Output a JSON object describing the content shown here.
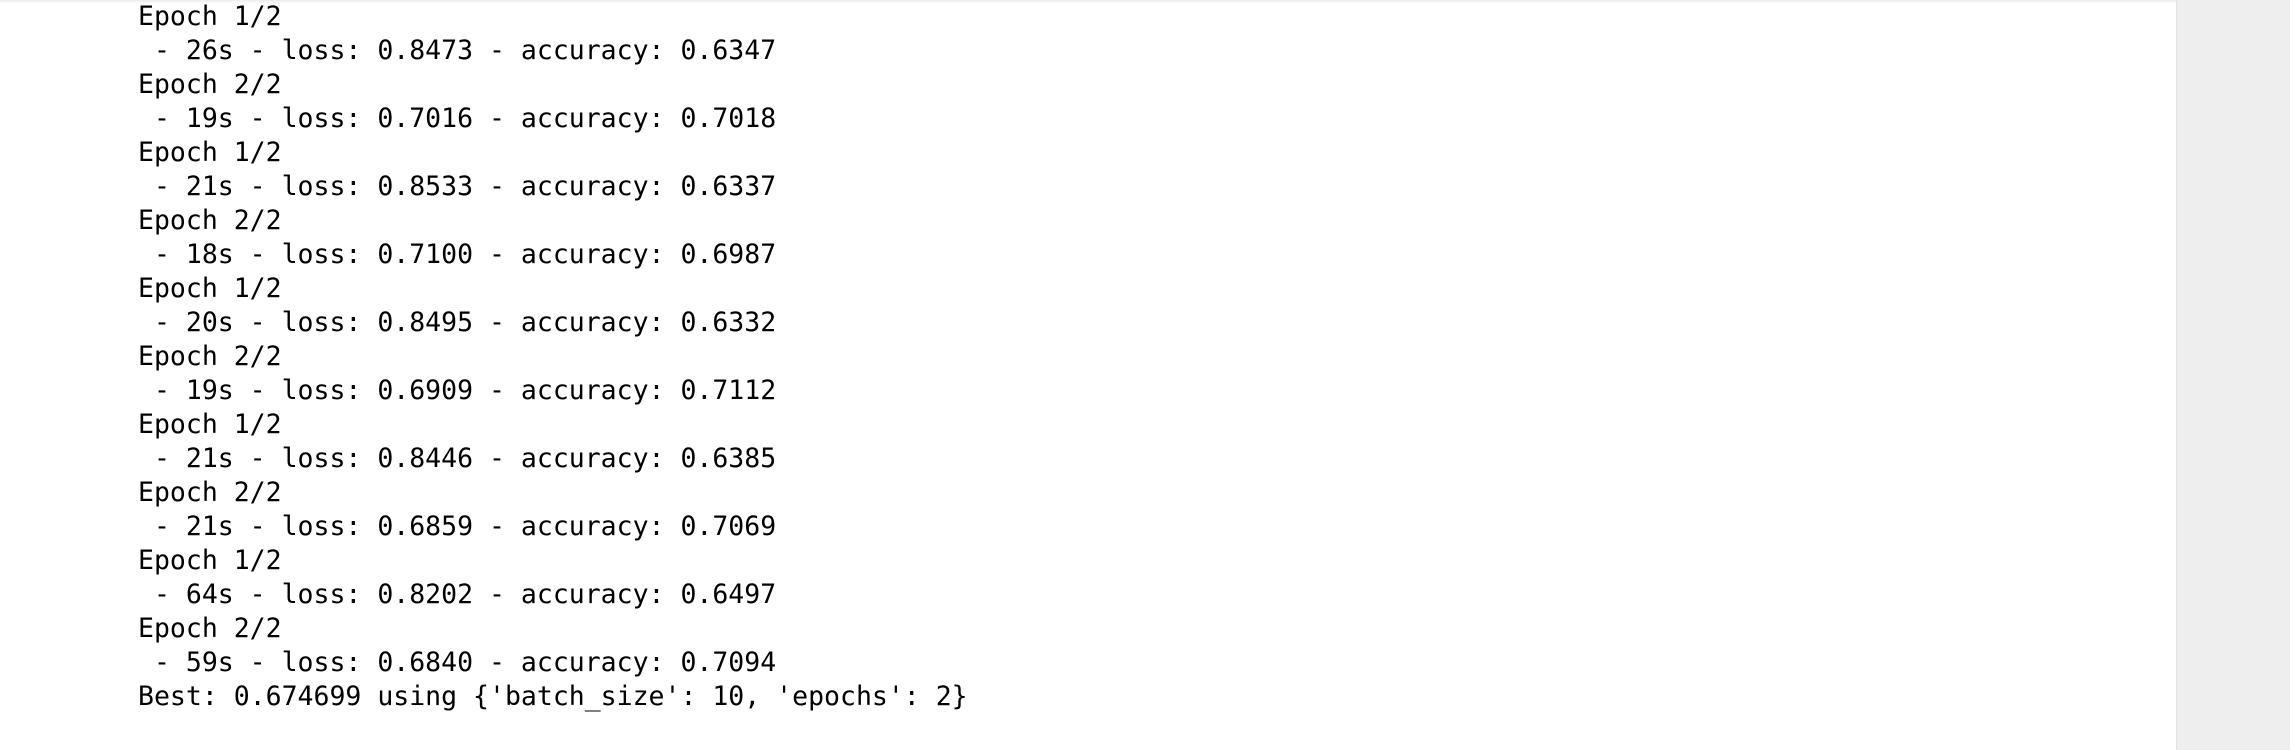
{
  "output": {
    "lines": [
      "Epoch 1/2",
      " - 26s - loss: 0.8473 - accuracy: 0.6347",
      "Epoch 2/2",
      " - 19s - loss: 0.7016 - accuracy: 0.7018",
      "Epoch 1/2",
      " - 21s - loss: 0.8533 - accuracy: 0.6337",
      "Epoch 2/2",
      " - 18s - loss: 0.7100 - accuracy: 0.6987",
      "Epoch 1/2",
      " - 20s - loss: 0.8495 - accuracy: 0.6332",
      "Epoch 2/2",
      " - 19s - loss: 0.6909 - accuracy: 0.7112",
      "Epoch 1/2",
      " - 21s - loss: 0.8446 - accuracy: 0.6385",
      "Epoch 2/2",
      " - 21s - loss: 0.6859 - accuracy: 0.7069",
      "Epoch 1/2",
      " - 64s - loss: 0.8202 - accuracy: 0.6497",
      "Epoch 2/2",
      " - 59s - loss: 0.6840 - accuracy: 0.7094",
      "Best: 0.674699 using {'batch_size': 10, 'epochs': 2}"
    ]
  },
  "colors": {
    "text": "#000000",
    "background": "#ffffff",
    "gutter": "#eeeeee"
  }
}
